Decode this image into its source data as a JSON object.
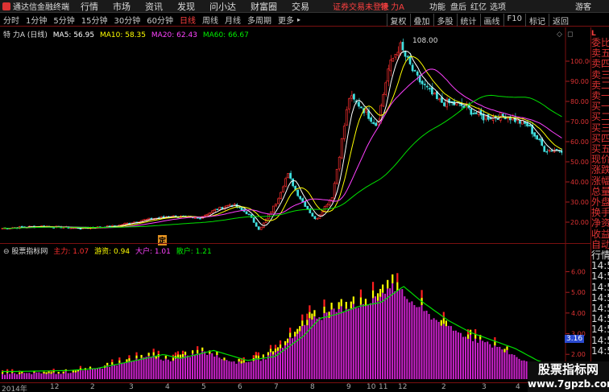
{
  "titlebar": {
    "app_title": "通达信金融终端",
    "menu": [
      "行情",
      "市场",
      "资讯",
      "发现",
      "问小达",
      "财富圈",
      "交易"
    ],
    "warning": "证券交易未登录",
    "security": "特 力A",
    "right": [
      "功能",
      "盘后",
      "红亿",
      "选项",
      "游客"
    ]
  },
  "periods": [
    "分时",
    "1分钟",
    "5分钟",
    "15分钟",
    "30分钟",
    "60分钟",
    "日线",
    "周线",
    "月线",
    "多周期",
    "更多"
  ],
  "active_period": "日线",
  "tools": [
    "复权",
    "叠加",
    "多股",
    "统计",
    "画线",
    "F10",
    "标记",
    "返回"
  ],
  "main_legend": {
    "name": "特 力A (日线)",
    "items": [
      {
        "label": "MA5: 56.95",
        "color": "#ffffff"
      },
      {
        "label": "MA10: 58.35",
        "color": "#ffff00"
      },
      {
        "label": "MA20: 62.43",
        "color": "#ff40ff"
      },
      {
        "label": "MA60: 66.67",
        "color": "#00e000"
      }
    ]
  },
  "indicator_legend": {
    "name": "股票指标网",
    "items": [
      {
        "label": "主力: 1.07",
        "color": "#ff3030"
      },
      {
        "label": "游资: 0.94",
        "color": "#ffff00"
      },
      {
        "label": "大户: 1.01",
        "color": "#ff40ff"
      },
      {
        "label": "散户: 1.21",
        "color": "#00e000"
      }
    ]
  },
  "high_label": "108.00",
  "marker_label": "定",
  "current_value_label": "3.16",
  "watermark": {
    "line1": "股票指标网",
    "line2": "www.7gpzb.com"
  },
  "x_axis_labels": [
    "2014年",
    "12",
    "2",
    "3",
    "4",
    "5",
    "6",
    "7",
    "8",
    "9",
    "10",
    "11",
    "12",
    "2",
    "3",
    "4"
  ],
  "right_panel": {
    "header": "L",
    "labels": [
      "委比",
      "卖五",
      "卖四",
      "卖三",
      "卖二",
      "卖一",
      "买一",
      "买二",
      "买三",
      "买四",
      "买五",
      "现价",
      "涨跌",
      "涨幅",
      "总量",
      "外盘",
      "换手",
      "净资",
      "收益",
      "自动",
      "行情"
    ],
    "ticks": [
      "14:5",
      "14:5",
      "14:5",
      "14:5",
      "14:5",
      "14:5",
      "14:5",
      "14:5",
      "14:5"
    ]
  },
  "chart_data": [
    {
      "type": "candlestick",
      "title": "特 力A (日线)",
      "y_axis_ticks": [
        20.0,
        30.0,
        40.0,
        50.0,
        60.0,
        70.0,
        80.0,
        90.0,
        100.0
      ],
      "ylim": [
        12,
        112
      ],
      "max_label": 108.0,
      "close_path": [
        [
          0,
          17
        ],
        [
          0.07,
          18
        ],
        [
          0.14,
          17
        ],
        [
          0.2,
          18
        ],
        [
          0.25,
          21
        ],
        [
          0.3,
          23
        ],
        [
          0.35,
          22
        ],
        [
          0.38,
          26
        ],
        [
          0.41,
          29
        ],
        [
          0.44,
          24
        ],
        [
          0.46,
          16
        ],
        [
          0.49,
          30
        ],
        [
          0.51,
          44
        ],
        [
          0.53,
          33
        ],
        [
          0.56,
          21
        ],
        [
          0.59,
          33
        ],
        [
          0.62,
          82
        ],
        [
          0.64,
          78
        ],
        [
          0.67,
          68
        ],
        [
          0.69,
          96
        ],
        [
          0.71,
          108
        ],
        [
          0.74,
          92
        ],
        [
          0.78,
          80
        ],
        [
          0.82,
          78
        ],
        [
          0.86,
          72
        ],
        [
          0.9,
          73
        ],
        [
          0.94,
          68
        ],
        [
          0.97,
          56
        ]
      ],
      "series": [
        {
          "name": "MA5",
          "value": 56.95,
          "color": "#ffffff"
        },
        {
          "name": "MA10",
          "value": 58.35,
          "color": "#ffff00"
        },
        {
          "name": "MA20",
          "value": 62.43,
          "color": "#ff40ff"
        },
        {
          "name": "MA60",
          "value": 66.67,
          "color": "#00e000"
        }
      ]
    },
    {
      "type": "bar",
      "title": "股票指标网",
      "y_axis_ticks": [
        1.0,
        2.0,
        3.0,
        4.0,
        5.0,
        6.0
      ],
      "ylim": [
        0.8,
        6.8
      ],
      "series": [
        {
          "name": "主力",
          "value": 1.07,
          "color": "#ff3030"
        },
        {
          "name": "游资",
          "value": 0.94,
          "color": "#ffff00"
        },
        {
          "name": "大户",
          "value": 1.01,
          "color": "#ff40ff"
        },
        {
          "name": "散户",
          "value": 1.21,
          "color": "#00e000"
        }
      ]
    }
  ]
}
